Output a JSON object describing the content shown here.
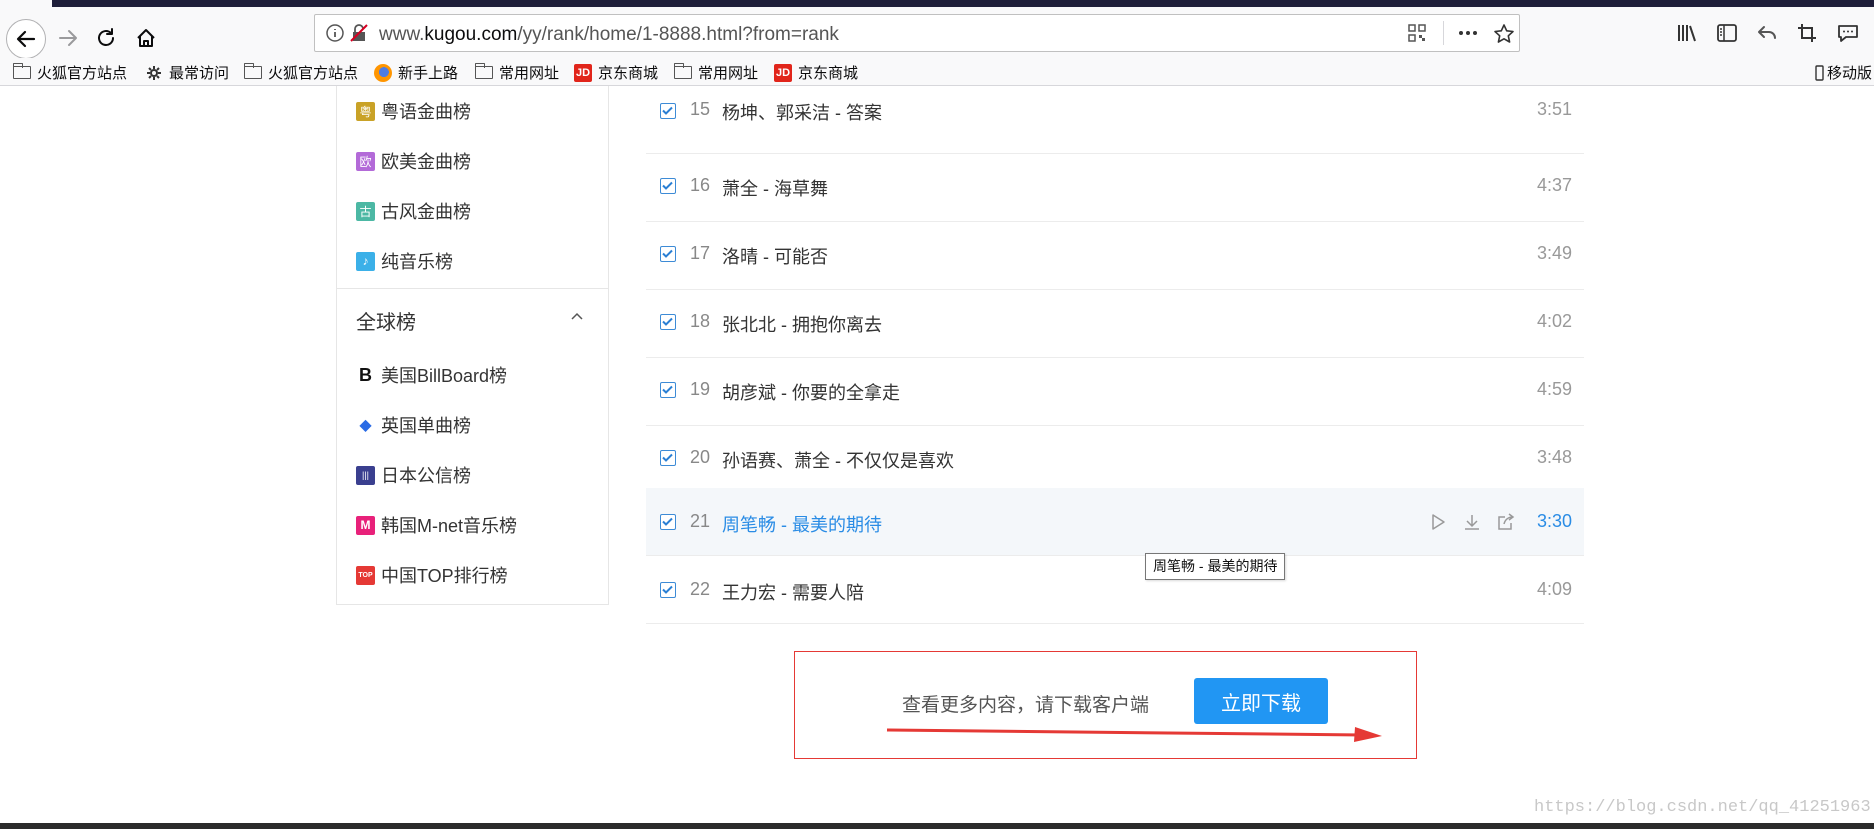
{
  "browser": {
    "url_prefix": "www.",
    "url_host": "kugou.com",
    "url_path": "/yy/rank/home/1-8888.html?from=rank",
    "bookmarks": [
      {
        "label": "火狐官方站点",
        "icon": "folder-icon"
      },
      {
        "label": "最常访问",
        "icon": "gear-icon"
      },
      {
        "label": "火狐官方站点",
        "icon": "folder-icon"
      },
      {
        "label": "新手上路",
        "icon": "firefox-icon"
      },
      {
        "label": "常用网址",
        "icon": "folder-icon"
      },
      {
        "label": "京东商城",
        "icon": "jd-icon"
      },
      {
        "label": "常用网址",
        "icon": "folder-icon"
      },
      {
        "label": "京东商城",
        "icon": "jd-icon"
      }
    ],
    "mobile_bookmarks": "移动版"
  },
  "sidebar": {
    "items": [
      {
        "label": "粤语金曲榜",
        "glyph": "粤",
        "color": "#c9a227"
      },
      {
        "label": "欧美金曲榜",
        "glyph": "欧",
        "color": "#b36ad8"
      },
      {
        "label": "古风金曲榜",
        "glyph": "古",
        "color": "#4cb8a4"
      },
      {
        "label": "纯音乐榜",
        "glyph": "♪",
        "color": "#3bb0e8"
      }
    ],
    "section_title": "全球榜",
    "global_items": [
      {
        "label": "美国BillBoard榜",
        "glyph": "B",
        "color": "#111111"
      },
      {
        "label": "英国单曲榜",
        "glyph": "◆",
        "color": "#2a6be5"
      },
      {
        "label": "日本公信榜",
        "glyph": "|||",
        "color": "#3a3f8f"
      },
      {
        "label": "韩国M-net音乐榜",
        "glyph": "M",
        "color": "#e8217a"
      },
      {
        "label": "中国TOP排行榜",
        "glyph": "TOP",
        "color": "#e53935"
      }
    ]
  },
  "songs": [
    {
      "num": "15",
      "title": "杨坤、郭采洁 - 答案",
      "duration": "3:51",
      "checked": true
    },
    {
      "num": "16",
      "title": "萧全 - 海草舞",
      "duration": "4:37",
      "checked": true
    },
    {
      "num": "17",
      "title": "洛晴 - 可能否",
      "duration": "3:49",
      "checked": true
    },
    {
      "num": "18",
      "title": "张北北 - 拥抱你离去",
      "duration": "4:02",
      "checked": true
    },
    {
      "num": "19",
      "title": "胡彦斌 - 你要的全拿走",
      "duration": "4:59",
      "checked": true
    },
    {
      "num": "20",
      "title": "孙语赛、萧全 - 不仅仅是喜欢",
      "duration": "3:48",
      "checked": true
    },
    {
      "num": "21",
      "title": "周笔畅 - 最美的期待",
      "duration": "3:30",
      "checked": true,
      "highlighted": true
    },
    {
      "num": "22",
      "title": "王力宏 - 需要人陪",
      "duration": "4:09",
      "checked": true
    }
  ],
  "tooltip": "周笔畅 - 最美的期待",
  "promo": {
    "text": "查看更多内容，请下载客户端",
    "button": "立即下载"
  },
  "watermark": "https://blog.csdn.net/qq_41251963",
  "colors": {
    "accent": "#2196f3",
    "highlight_text": "#2a8ce5",
    "promo_border": "#e53935"
  }
}
